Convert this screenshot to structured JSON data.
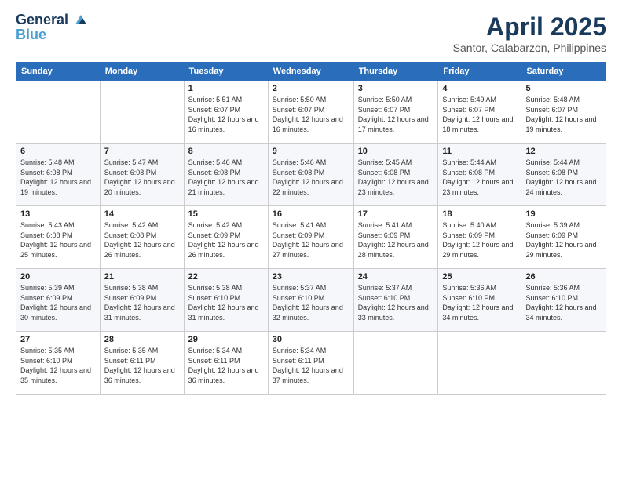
{
  "header": {
    "logo_line1": "General",
    "logo_line2": "Blue",
    "month": "April 2025",
    "location": "Santor, Calabarzon, Philippines"
  },
  "days_of_week": [
    "Sunday",
    "Monday",
    "Tuesday",
    "Wednesday",
    "Thursday",
    "Friday",
    "Saturday"
  ],
  "weeks": [
    [
      {
        "day": "",
        "sunrise": "",
        "sunset": "",
        "daylight": ""
      },
      {
        "day": "",
        "sunrise": "",
        "sunset": "",
        "daylight": ""
      },
      {
        "day": "1",
        "sunrise": "Sunrise: 5:51 AM",
        "sunset": "Sunset: 6:07 PM",
        "daylight": "Daylight: 12 hours and 16 minutes."
      },
      {
        "day": "2",
        "sunrise": "Sunrise: 5:50 AM",
        "sunset": "Sunset: 6:07 PM",
        "daylight": "Daylight: 12 hours and 16 minutes."
      },
      {
        "day": "3",
        "sunrise": "Sunrise: 5:50 AM",
        "sunset": "Sunset: 6:07 PM",
        "daylight": "Daylight: 12 hours and 17 minutes."
      },
      {
        "day": "4",
        "sunrise": "Sunrise: 5:49 AM",
        "sunset": "Sunset: 6:07 PM",
        "daylight": "Daylight: 12 hours and 18 minutes."
      },
      {
        "day": "5",
        "sunrise": "Sunrise: 5:48 AM",
        "sunset": "Sunset: 6:07 PM",
        "daylight": "Daylight: 12 hours and 19 minutes."
      }
    ],
    [
      {
        "day": "6",
        "sunrise": "Sunrise: 5:48 AM",
        "sunset": "Sunset: 6:08 PM",
        "daylight": "Daylight: 12 hours and 19 minutes."
      },
      {
        "day": "7",
        "sunrise": "Sunrise: 5:47 AM",
        "sunset": "Sunset: 6:08 PM",
        "daylight": "Daylight: 12 hours and 20 minutes."
      },
      {
        "day": "8",
        "sunrise": "Sunrise: 5:46 AM",
        "sunset": "Sunset: 6:08 PM",
        "daylight": "Daylight: 12 hours and 21 minutes."
      },
      {
        "day": "9",
        "sunrise": "Sunrise: 5:46 AM",
        "sunset": "Sunset: 6:08 PM",
        "daylight": "Daylight: 12 hours and 22 minutes."
      },
      {
        "day": "10",
        "sunrise": "Sunrise: 5:45 AM",
        "sunset": "Sunset: 6:08 PM",
        "daylight": "Daylight: 12 hours and 23 minutes."
      },
      {
        "day": "11",
        "sunrise": "Sunrise: 5:44 AM",
        "sunset": "Sunset: 6:08 PM",
        "daylight": "Daylight: 12 hours and 23 minutes."
      },
      {
        "day": "12",
        "sunrise": "Sunrise: 5:44 AM",
        "sunset": "Sunset: 6:08 PM",
        "daylight": "Daylight: 12 hours and 24 minutes."
      }
    ],
    [
      {
        "day": "13",
        "sunrise": "Sunrise: 5:43 AM",
        "sunset": "Sunset: 6:08 PM",
        "daylight": "Daylight: 12 hours and 25 minutes."
      },
      {
        "day": "14",
        "sunrise": "Sunrise: 5:42 AM",
        "sunset": "Sunset: 6:08 PM",
        "daylight": "Daylight: 12 hours and 26 minutes."
      },
      {
        "day": "15",
        "sunrise": "Sunrise: 5:42 AM",
        "sunset": "Sunset: 6:09 PM",
        "daylight": "Daylight: 12 hours and 26 minutes."
      },
      {
        "day": "16",
        "sunrise": "Sunrise: 5:41 AM",
        "sunset": "Sunset: 6:09 PM",
        "daylight": "Daylight: 12 hours and 27 minutes."
      },
      {
        "day": "17",
        "sunrise": "Sunrise: 5:41 AM",
        "sunset": "Sunset: 6:09 PM",
        "daylight": "Daylight: 12 hours and 28 minutes."
      },
      {
        "day": "18",
        "sunrise": "Sunrise: 5:40 AM",
        "sunset": "Sunset: 6:09 PM",
        "daylight": "Daylight: 12 hours and 29 minutes."
      },
      {
        "day": "19",
        "sunrise": "Sunrise: 5:39 AM",
        "sunset": "Sunset: 6:09 PM",
        "daylight": "Daylight: 12 hours and 29 minutes."
      }
    ],
    [
      {
        "day": "20",
        "sunrise": "Sunrise: 5:39 AM",
        "sunset": "Sunset: 6:09 PM",
        "daylight": "Daylight: 12 hours and 30 minutes."
      },
      {
        "day": "21",
        "sunrise": "Sunrise: 5:38 AM",
        "sunset": "Sunset: 6:09 PM",
        "daylight": "Daylight: 12 hours and 31 minutes."
      },
      {
        "day": "22",
        "sunrise": "Sunrise: 5:38 AM",
        "sunset": "Sunset: 6:10 PM",
        "daylight": "Daylight: 12 hours and 31 minutes."
      },
      {
        "day": "23",
        "sunrise": "Sunrise: 5:37 AM",
        "sunset": "Sunset: 6:10 PM",
        "daylight": "Daylight: 12 hours and 32 minutes."
      },
      {
        "day": "24",
        "sunrise": "Sunrise: 5:37 AM",
        "sunset": "Sunset: 6:10 PM",
        "daylight": "Daylight: 12 hours and 33 minutes."
      },
      {
        "day": "25",
        "sunrise": "Sunrise: 5:36 AM",
        "sunset": "Sunset: 6:10 PM",
        "daylight": "Daylight: 12 hours and 34 minutes."
      },
      {
        "day": "26",
        "sunrise": "Sunrise: 5:36 AM",
        "sunset": "Sunset: 6:10 PM",
        "daylight": "Daylight: 12 hours and 34 minutes."
      }
    ],
    [
      {
        "day": "27",
        "sunrise": "Sunrise: 5:35 AM",
        "sunset": "Sunset: 6:10 PM",
        "daylight": "Daylight: 12 hours and 35 minutes."
      },
      {
        "day": "28",
        "sunrise": "Sunrise: 5:35 AM",
        "sunset": "Sunset: 6:11 PM",
        "daylight": "Daylight: 12 hours and 36 minutes."
      },
      {
        "day": "29",
        "sunrise": "Sunrise: 5:34 AM",
        "sunset": "Sunset: 6:11 PM",
        "daylight": "Daylight: 12 hours and 36 minutes."
      },
      {
        "day": "30",
        "sunrise": "Sunrise: 5:34 AM",
        "sunset": "Sunset: 6:11 PM",
        "daylight": "Daylight: 12 hours and 37 minutes."
      },
      {
        "day": "",
        "sunrise": "",
        "sunset": "",
        "daylight": ""
      },
      {
        "day": "",
        "sunrise": "",
        "sunset": "",
        "daylight": ""
      },
      {
        "day": "",
        "sunrise": "",
        "sunset": "",
        "daylight": ""
      }
    ]
  ]
}
